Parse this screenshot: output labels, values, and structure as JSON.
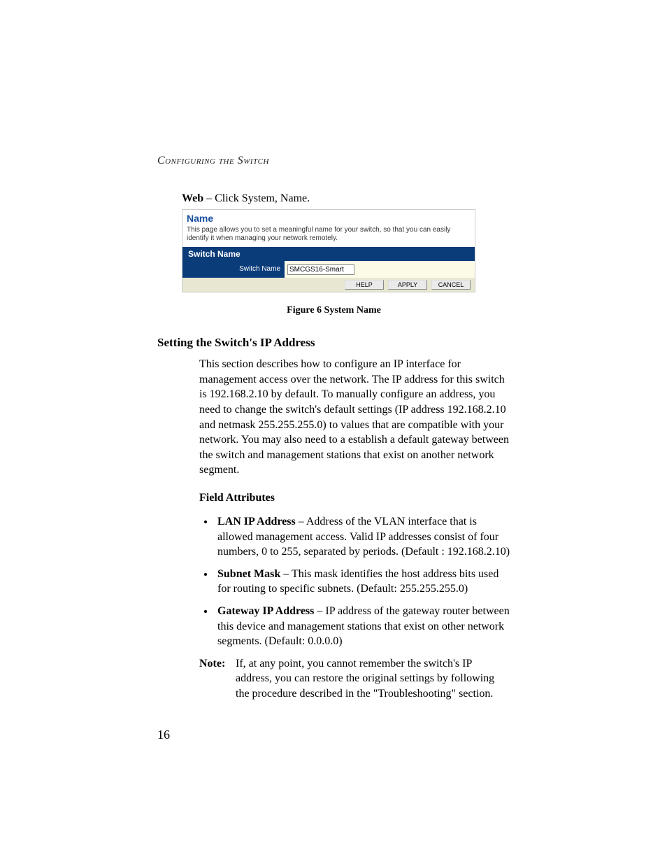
{
  "running_head": "Configuring the Switch",
  "web_line_bold": "Web",
  "web_line_rest": " – Click System, Name.",
  "switch_ui": {
    "title": "Name",
    "description": "This page allows you to set a meaningful name for your switch, so that you can easily identify it when managing your network remotely.",
    "section_bar": "Switch Name",
    "form_label": "Switch Name",
    "form_value": "SMCGS16-Smart",
    "buttons": {
      "help": "HELP",
      "apply": "APPLY",
      "cancel": "CANCEL"
    }
  },
  "figure_caption": "Figure 6  System Name",
  "subsection_heading": "Setting the Switch's IP Address",
  "intro_paragraph": "This section describes how to configure an IP interface for management access over the network. The IP address for this switch is 192.168.2.10 by default. To manually configure an address, you need to change the switch's default settings (IP address 192.168.2.10 and netmask 255.255.255.0) to values that are compatible with your network. You may also need to a establish a default gateway between the switch and management stations that exist on another network segment.",
  "field_attributes_heading": "Field Attributes",
  "attrs": [
    {
      "term": "LAN IP Address",
      "desc": " – Address of the VLAN interface that is allowed management access. Valid IP addresses consist of four numbers, 0 to 255, separated by periods.  (Default : 192.168.2.10)"
    },
    {
      "term": "Subnet Mask",
      "desc": " – This mask identifies the host address bits used for routing to specific subnets. (Default: 255.255.255.0)"
    },
    {
      "term": "Gateway IP Address",
      "desc": " – IP address of the gateway router between this device and management stations that exist on other network segments. (Default: 0.0.0.0)"
    }
  ],
  "note_label": "Note:",
  "note_text": "If, at any point, you cannot remember the switch's IP address, you can restore the original settings by following the procedure described in the \"Troubleshooting\" section.",
  "page_number": "16"
}
